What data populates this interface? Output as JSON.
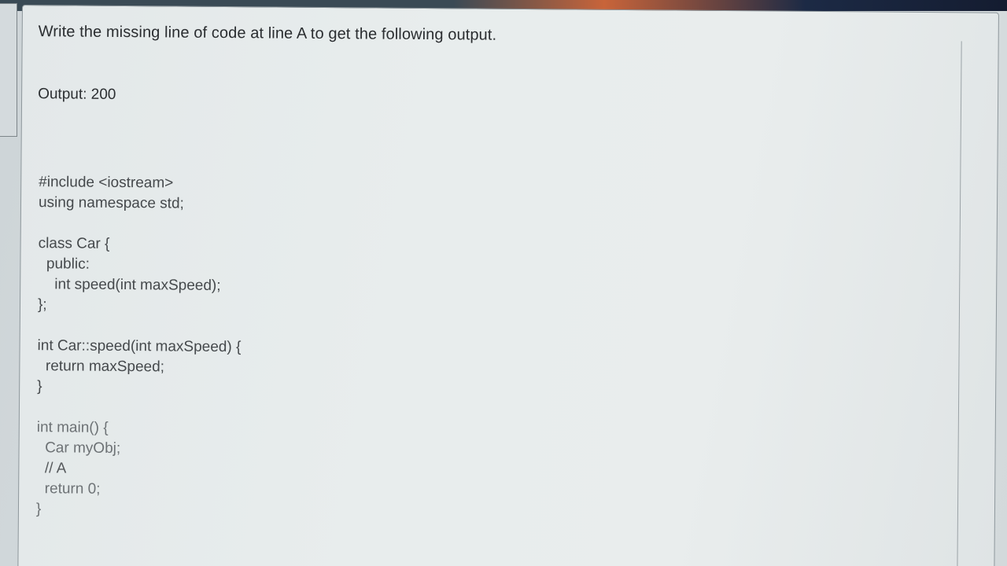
{
  "question": {
    "prompt": "Write the missing line of code at line A to get the following output.",
    "output": "Output: 200"
  },
  "code_lines": [
    "#include <iostream>",
    "using namespace std;",
    "",
    "class Car {",
    "  public:",
    "    int speed(int maxSpeed);",
    "};",
    "",
    "int Car::speed(int maxSpeed) {",
    "  return maxSpeed;",
    "}",
    "",
    "int main() {",
    "  Car myObj;",
    "  // A",
    "  return 0;",
    "}"
  ]
}
